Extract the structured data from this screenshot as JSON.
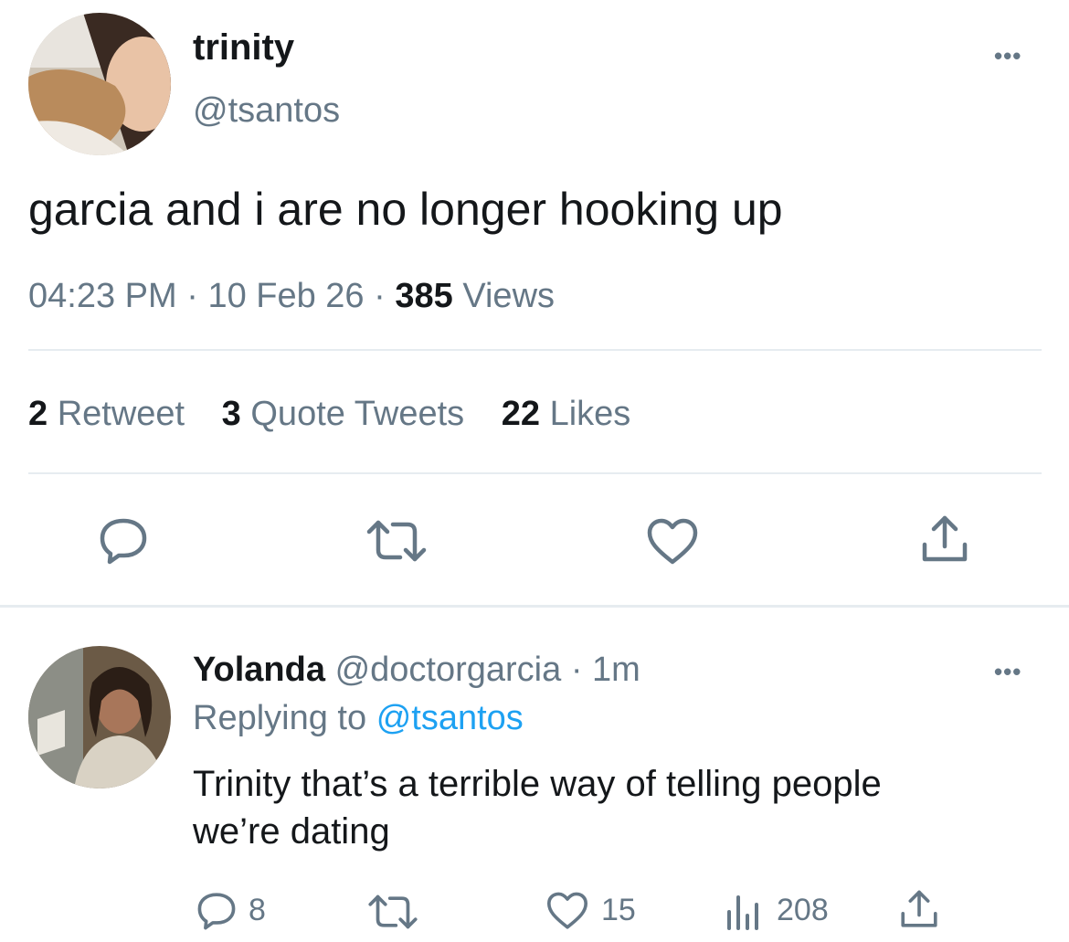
{
  "main_tweet": {
    "display_name": "trinity",
    "handle": "@tsantos",
    "more_label": "•••",
    "text": "garcia and i are no longer hooking up",
    "time": "04:23 PM",
    "sep": "·",
    "date": "10 Feb 26",
    "views_count": "385",
    "views_label": "Views",
    "stats": {
      "retweets_count": "2",
      "retweets_label": "Retweet",
      "quotes_count": "3",
      "quotes_label": "Quote Tweets",
      "likes_count": "22",
      "likes_label": "Likes"
    },
    "actions": [
      "reply-icon",
      "retweet-icon",
      "like-icon",
      "share-icon"
    ]
  },
  "reply": {
    "display_name": "Yolanda",
    "handle": "@doctorgarcia",
    "sep": "·",
    "time": "1m",
    "more_label": "•••",
    "replying_prefix": "Replying to",
    "replying_handle": "@tsantos",
    "text_line1": "Trinity that’s a terrible way of telling people",
    "text_line2": "we’re dating",
    "reply_count": "8",
    "like_count": "15",
    "views_count": "208"
  },
  "colors": {
    "text": "#14171a",
    "secondary": "#657786",
    "accent": "#1da1f2",
    "divider": "#e6ecf0"
  }
}
